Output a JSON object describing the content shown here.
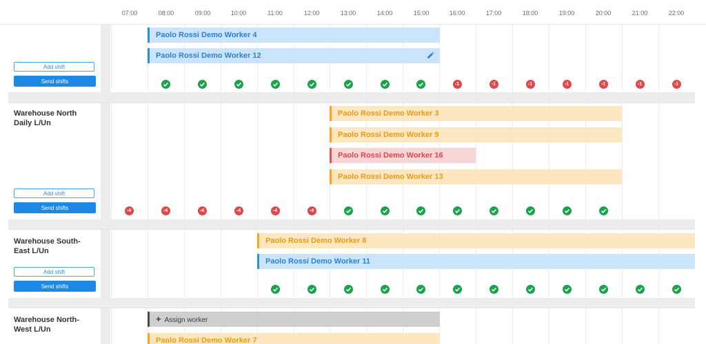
{
  "time_slots": [
    "07:00",
    "08:00",
    "09:00",
    "10:00",
    "11:00",
    "12:00",
    "13:00",
    "14:00",
    "15:00",
    "16:00",
    "17:00",
    "18:00",
    "19:00",
    "20:00",
    "21:00",
    "22:00"
  ],
  "buttons": {
    "add_shift": "Add shift",
    "send_shifts": "Send shifts"
  },
  "sections": [
    {
      "title": "",
      "shifts": [
        {
          "worker": "Paolo Rossi Demo Worker 4",
          "color": "blue"
        },
        {
          "worker": "Paolo Rossi Demo Worker 12",
          "color": "blue",
          "icon": "pencil-icon"
        }
      ],
      "status": [
        null,
        "ok",
        "ok",
        "ok",
        "ok",
        "ok",
        "ok",
        "ok",
        "ok",
        "-1",
        "-1",
        "-1",
        "-1",
        "-1",
        "-1",
        "-1"
      ]
    },
    {
      "title": "Warehouse North Daily L/Un",
      "shifts": [
        {
          "worker": "Paolo Rossi Demo Worker 3",
          "color": "orange"
        },
        {
          "worker": "Paolo Rossi Demo Worker 9",
          "color": "orange"
        },
        {
          "worker": "Paolo Rossi Demo Worker 16",
          "color": "red"
        },
        {
          "worker": "Paolo Rossi Demo Worker 13",
          "color": "orange"
        }
      ],
      "status": [
        "-4",
        "-4",
        "-4",
        "-4",
        "-4",
        "-4",
        "ok",
        "ok",
        "ok",
        "ok",
        "ok",
        "ok",
        "ok",
        "ok",
        null,
        null
      ]
    },
    {
      "title": "Warehouse South-East L/Un",
      "shifts": [
        {
          "worker": "Paolo Rossi Demo Worker 8",
          "color": "orange"
        },
        {
          "worker": "Paolo Rossi Demo Worker 11",
          "color": "blue"
        }
      ],
      "status": [
        null,
        null,
        null,
        null,
        "ok",
        "ok",
        "ok",
        "ok",
        "ok",
        "ok",
        "ok",
        "ok",
        "ok",
        "ok",
        "ok",
        "ok"
      ]
    },
    {
      "title": "Warehouse North-West L/Un",
      "shifts": [
        {
          "worker": "Assign worker",
          "color": "gray",
          "icon": "plus-icon"
        },
        {
          "worker": "Paolo Rossi Demo Worker 7",
          "color": "orange"
        }
      ],
      "status": []
    }
  ],
  "colors": {
    "accent": "#1e88e5",
    "ok": "#1aa34a",
    "bad": "#e04848"
  }
}
